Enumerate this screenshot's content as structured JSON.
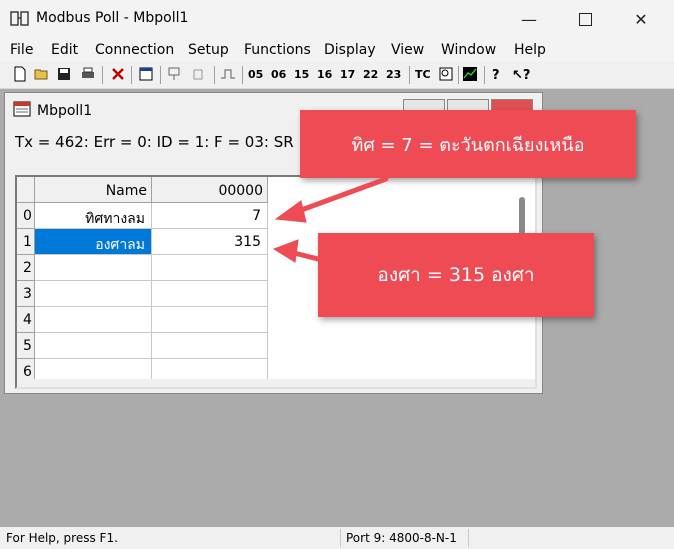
{
  "window": {
    "title": "Modbus Poll - Mbpoll1"
  },
  "menu": [
    "File",
    "Edit",
    "Connection",
    "Setup",
    "Functions",
    "Display",
    "View",
    "Window",
    "Help"
  ],
  "toolbar": {
    "function_codes": [
      "05",
      "06",
      "15",
      "16",
      "17",
      "22",
      "23"
    ],
    "tc_label": "TC"
  },
  "child": {
    "title": "Mbpoll1",
    "info": "Tx = 462: Err = 0: ID = 1: F = 03: SR",
    "columns": {
      "name": "Name",
      "address": "00000"
    },
    "rows": [
      {
        "index": "0",
        "name": "ทิศทางลม",
        "value": "7"
      },
      {
        "index": "1",
        "name": "องศาลม",
        "value": "315"
      },
      {
        "index": "2",
        "name": "",
        "value": ""
      },
      {
        "index": "3",
        "name": "",
        "value": ""
      },
      {
        "index": "4",
        "name": "",
        "value": ""
      },
      {
        "index": "5",
        "name": "",
        "value": ""
      },
      {
        "index": "6",
        "name": "",
        "value": ""
      }
    ]
  },
  "callouts": {
    "direction": "ทิศ = 7 = ตะวันตกเฉียงเหนือ",
    "degree": "องศา = 315 องศา"
  },
  "status": {
    "help": "For Help, press F1.",
    "port": "Port 9: 4800-8-N-1"
  },
  "colors": {
    "callout": "#ef4b55",
    "selection": "#0078d7",
    "client_bg": "#ababab"
  }
}
